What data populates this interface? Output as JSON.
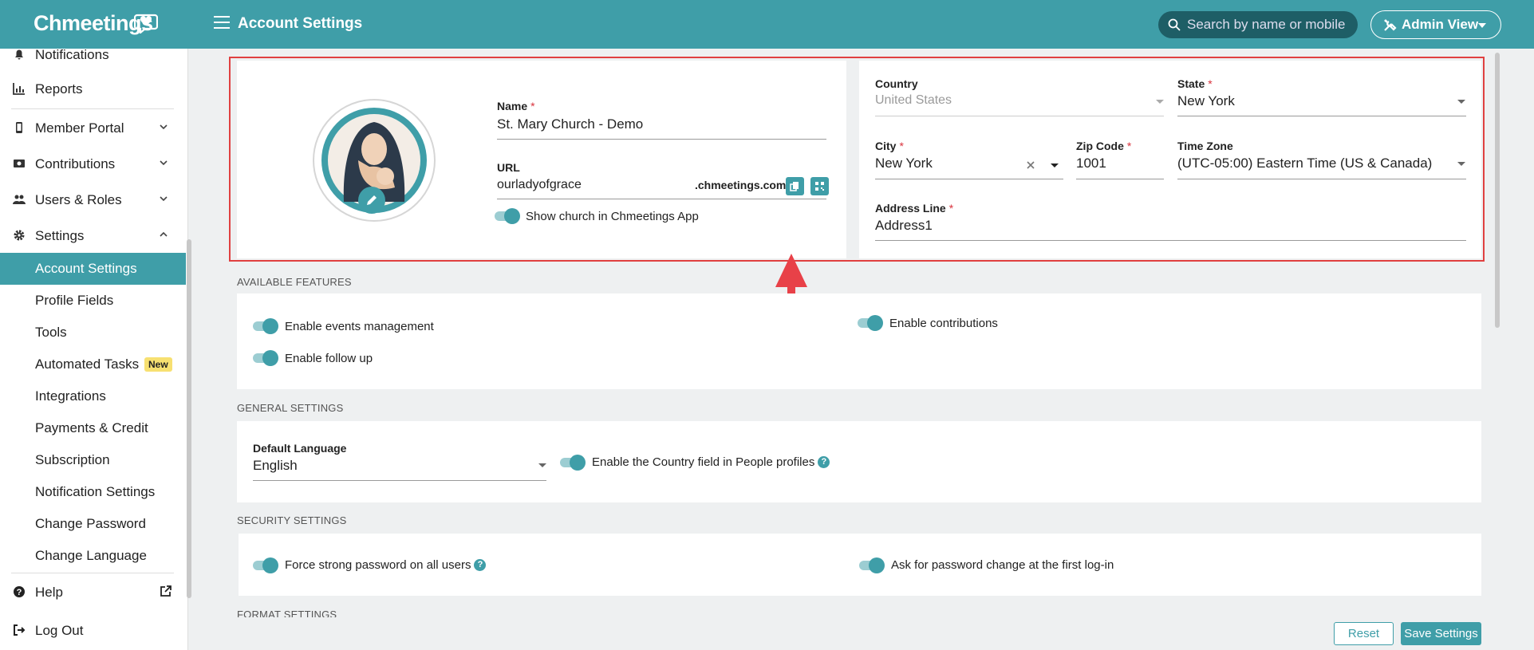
{
  "app": {
    "logo_text": "Chmeetings",
    "page_title": "Account Settings"
  },
  "header": {
    "search_placeholder": "Search by name or mobile",
    "admin_view_label": "Admin View"
  },
  "sidebar": {
    "top_items": [
      {
        "label": "Notifications",
        "icon": "bell-icon"
      },
      {
        "label": "Reports",
        "icon": "chart-icon"
      },
      {
        "label": "Member Portal",
        "icon": "phone-icon"
      },
      {
        "label": "Contributions",
        "icon": "money-icon"
      },
      {
        "label": "Users & Roles",
        "icon": "users-icon"
      },
      {
        "label": "Settings",
        "icon": "gear-icon"
      }
    ],
    "settings_items": [
      {
        "label": "Account Settings"
      },
      {
        "label": "Profile Fields"
      },
      {
        "label": "Tools"
      },
      {
        "label": "Automated Tasks",
        "badge": "New"
      },
      {
        "label": "Integrations"
      },
      {
        "label": "Payments & Credit"
      },
      {
        "label": "Subscription"
      },
      {
        "label": "Notification Settings"
      },
      {
        "label": "Change Password"
      },
      {
        "label": "Change Language"
      }
    ],
    "bottom_items": [
      {
        "label": "Help",
        "icon": "help-icon"
      },
      {
        "label": "Log Out",
        "icon": "logout-icon"
      }
    ]
  },
  "account": {
    "name_label": "Name",
    "name_value": "St. Mary Church - Demo",
    "url_label": "URL",
    "url_value": "ourladyofgrace",
    "url_suffix": ".chmeetings.com",
    "show_in_app_label": "Show church in Chmeetings App",
    "country_label": "Country",
    "country_value": "United States",
    "state_label": "State",
    "state_value": "New York",
    "city_label": "City",
    "city_value": "New York",
    "zip_label": "Zip Code",
    "zip_value": "1001",
    "timezone_label": "Time Zone",
    "timezone_value": "(UTC-05:00) Eastern Time (US & Canada)",
    "address_label": "Address Line",
    "address_value": "Address1",
    "required_mark": "*"
  },
  "features": {
    "title": "AVAILABLE FEATURES",
    "events": "Enable events management",
    "followup": "Enable follow up",
    "contributions": "Enable contributions"
  },
  "general": {
    "title": "GENERAL SETTINGS",
    "language_label": "Default Language",
    "language_value": "English",
    "country_field_label": "Enable the Country field in People profiles"
  },
  "security": {
    "title": "SECURITY SETTINGS",
    "strong_pw": "Force strong password on all users",
    "pw_change": "Ask for password change at the first log-in"
  },
  "format": {
    "title": "FORMAT SETTINGS"
  },
  "actions": {
    "reset": "Reset",
    "save": "Save Settings"
  },
  "colors": {
    "brand": "#3f9ea8",
    "highlight": "#e04040",
    "required": "#d9323c"
  }
}
